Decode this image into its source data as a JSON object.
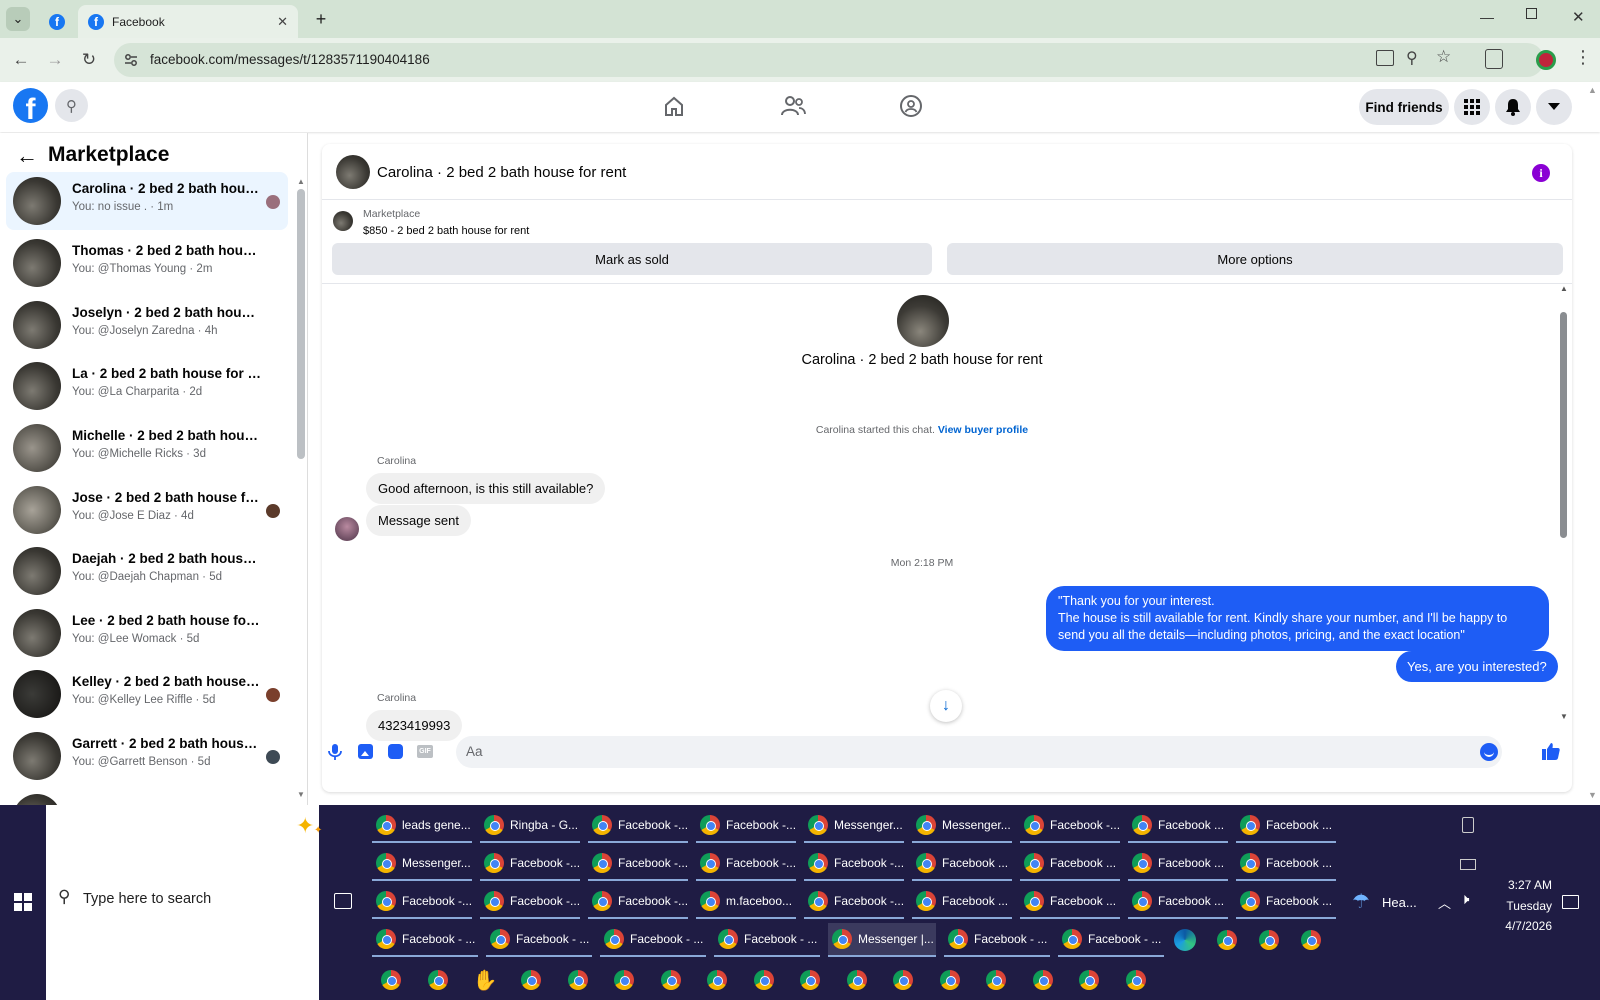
{
  "browser": {
    "tabs": [
      {
        "label": "Facebook"
      }
    ],
    "url": "facebook.com/messages/t/1283571190404186"
  },
  "fb_header": {
    "find_friends": "Find friends"
  },
  "sidebar": {
    "title": "Marketplace",
    "conversations": [
      {
        "title": "Carolina · 2 bed 2 bath house ...",
        "sub": "You: no issue . · 1m",
        "selected": true
      },
      {
        "title": "Thomas · 2 bed 2 bath house fo...",
        "sub": "You: @Thomas Young · 2m"
      },
      {
        "title": "Joselyn · 2 bed 2 bath house for...",
        "sub": "You: @Joselyn Zaredna · 4h"
      },
      {
        "title": "La · 2 bed 2 bath house for rent",
        "sub": "You: @La Charparita · 2d"
      },
      {
        "title": "Michelle · 2 bed 2 bath house fo...",
        "sub": "You: @Michelle Ricks · 3d"
      },
      {
        "title": "Jose · 2 bed 2 bath house for ...",
        "sub": "You: @Jose E Diaz · 4d"
      },
      {
        "title": "Daejah · 2 bed 2 bath house for ...",
        "sub": "You: @Daejah Chapman · 5d"
      },
      {
        "title": "Lee · 2 bed 2 bath house for rent",
        "sub": "You: @Lee Womack · 5d"
      },
      {
        "title": "Kelley · 2 bed 2 bath house fo...",
        "sub": "You: @Kelley Lee Riffle · 5d"
      },
      {
        "title": "Garrett · 2 bed 2 bath house f...",
        "sub": "You: @Garrett Benson · 5d"
      }
    ]
  },
  "chat": {
    "header_title": "Carolina · 2 bed 2 bath house for rent",
    "listing_label": "Marketplace",
    "listing_price": "$850 - 2 bed 2 bath house for rent",
    "mark_sold": "Mark as sold",
    "more_options": "More options",
    "profile_name": "Carolina · 2 bed 2 bath house for rent",
    "started_text": "Carolina started this chat.",
    "view_buyer_profile": "View buyer profile",
    "sender_name_1": "Carolina",
    "msg_in_1": "Good afternoon, is this still available?",
    "msg_in_2": "Message sent",
    "timestamp": "Mon 2:18 PM",
    "msg_out_1_line1": "\"Thank you for your interest.",
    "msg_out_1_line2": "The house is still available for rent. Kindly share your number, and I'll be happy to",
    "msg_out_1_line3": "send you all the details—including photos, pricing, and the exact location\"",
    "msg_out_2": "Yes, are you interested?",
    "sender_name_2": "Carolina",
    "msg_in_3": "4323419993",
    "composer_placeholder": "Aa"
  },
  "taskbar": {
    "search_placeholder": "Type here to search",
    "weather": "Hea...",
    "time": "3:27 AM",
    "day": "Tuesday",
    "date": "4/7/2026",
    "rows": [
      [
        "leads gene...",
        "Ringba - G...",
        "Facebook -...",
        "Facebook -...",
        "Messenger...",
        "Messenger...",
        "Facebook -...",
        "Facebook ...",
        "Facebook ..."
      ],
      [
        "Messenger...",
        "Facebook -...",
        "Facebook -...",
        "Facebook -...",
        "Facebook -...",
        "Facebook ...",
        "Facebook ...",
        "Facebook ...",
        "Facebook ..."
      ],
      [
        "Facebook -...",
        "Facebook -...",
        "Facebook -...",
        "m.faceboo...",
        "Facebook -...",
        "Facebook ...",
        "Facebook ...",
        "Facebook ...",
        "Facebook ..."
      ],
      [
        "Facebook - ...",
        "Facebook - ...",
        "Facebook - ...",
        "Facebook - ...",
        "Messenger |...",
        "Facebook - ...",
        "Facebook - ..."
      ]
    ]
  },
  "colors": {
    "fb_blue": "#1877f2",
    "outgoing_bubble": "#1e5df5",
    "link_blue": "#0064d1",
    "taskbar_bg": "#1f1c44"
  }
}
